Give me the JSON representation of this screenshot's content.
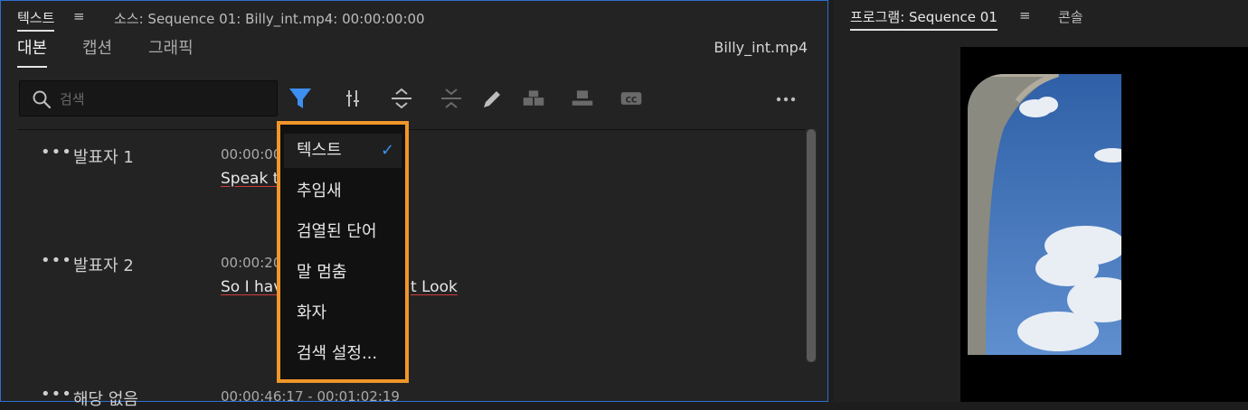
{
  "source_panel": {
    "tab_title": "텍스트",
    "source_label": "소스: Sequence 01: Billy_int.mp4: 00:00:00:00",
    "subtabs": [
      "대본",
      "캡션",
      "그래픽"
    ],
    "file_name": "Billy_int.mp4"
  },
  "search": {
    "placeholder": "검색",
    "value": ""
  },
  "toolbar_icons": [
    "filter-icon",
    "split-segment-icon",
    "merge-segments-icon",
    "collapse-icon",
    "edit-pencil-icon",
    "speaker-block-icon",
    "insert-caption-icon",
    "cc-icon",
    "more-icon"
  ],
  "segments": [
    {
      "speaker": "발표자 1",
      "timecode": "00:00:00",
      "text": "Speak to"
    },
    {
      "speaker": "발표자 2",
      "timecode": "00:00:20",
      "text": "So I have",
      "text_tail": "t Look"
    },
    {
      "speaker": "해당 없음",
      "timecode": "00:00:46:17 - 00:01:02:19",
      "text": ""
    }
  ],
  "filter_menu": {
    "items": [
      "텍스트",
      "추임새",
      "검열된 단어",
      "말 멈춤",
      "화자",
      "검색 설정..."
    ],
    "selected_index": 0,
    "check_mark": "✓"
  },
  "program_panel": {
    "title": "프로그램: Sequence 01",
    "tab": "콘솔"
  },
  "colors": {
    "accent_blue": "#2d6fcf",
    "filter_blue": "#3d8ff0",
    "highlight_orange": "#f0962a",
    "underline_red": "#cf3a3a"
  }
}
